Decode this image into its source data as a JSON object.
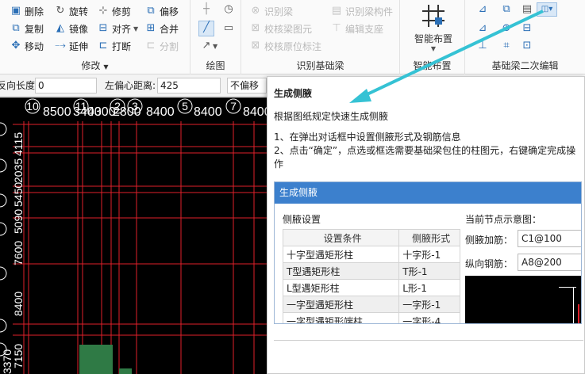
{
  "ribbon": {
    "modify": {
      "label": "修改",
      "buttons": [
        {
          "name": "delete",
          "label": "删除"
        },
        {
          "name": "rotate",
          "label": "旋转"
        },
        {
          "name": "trim",
          "label": "修剪"
        },
        {
          "name": "offset",
          "label": "偏移"
        },
        {
          "name": "copy",
          "label": "复制"
        },
        {
          "name": "mirror",
          "label": "镜像"
        },
        {
          "name": "align",
          "label": "对齐"
        },
        {
          "name": "merge",
          "label": "合并"
        },
        {
          "name": "move",
          "label": "移动"
        },
        {
          "name": "extend",
          "label": "延伸"
        },
        {
          "name": "break",
          "label": "打断"
        },
        {
          "name": "split",
          "label": "分割"
        }
      ]
    },
    "draw": {
      "label": "绘图"
    },
    "identify": {
      "label": "识别基础梁",
      "buttons": [
        {
          "name": "identify-beam",
          "label": "识别梁"
        },
        {
          "name": "identify-beam-member",
          "label": "识别梁构件"
        },
        {
          "name": "check-beam-diagram",
          "label": "校核梁图元"
        },
        {
          "name": "edit-support",
          "label": "编辑支座"
        },
        {
          "name": "check-original-label",
          "label": "校核原位标注"
        }
      ]
    },
    "smart": {
      "label": "智能布置",
      "button": "智能布置"
    },
    "second_edit": {
      "label": "基础梁二次编辑"
    }
  },
  "options": {
    "length_label": "反向长度:",
    "length_value": "0",
    "left_offset_label": "左偏心距离:",
    "left_offset_value": "425",
    "offset_mode": "不偏移"
  },
  "canvas": {
    "axis_labels_top": [
      "10",
      "11",
      "2",
      "3",
      "5",
      "7"
    ],
    "dims_top": [
      "8500",
      "3400",
      "4300",
      "2800",
      "8400",
      "8400",
      "8400"
    ],
    "dims_left": [
      "4115",
      "2035",
      "5450",
      "5090",
      "7600",
      "8400",
      "7150",
      "3370"
    ],
    "bg_color": "#000000",
    "grid_color": "#e0202a"
  },
  "tooltip": {
    "title": "生成侧腋",
    "desc": "根据图纸规定快速生成侧腋",
    "step1": "1、在弹出对话框中设置侧腋形式及钢筋信息",
    "step2": "2、点击“确定”，点选或框选需要基础梁包住的柱图元，右键确定完成操作",
    "dialog": {
      "title": "生成侧腋",
      "section_label": "侧腋设置",
      "preview_label": "当前节点示意图：",
      "columns": [
        "设置条件",
        "侧腋形式"
      ],
      "rows": [
        [
          "十字型遇矩形柱",
          "十字形-1"
        ],
        [
          "T型遇矩形柱",
          "T形-1"
        ],
        [
          "L型遇矩形柱",
          "L形-1"
        ],
        [
          "一字型遇矩形柱",
          "一字形-1"
        ],
        [
          "一字型遇矩形端柱",
          "一字形-4"
        ]
      ],
      "rebar_label": "侧腋加筋：",
      "rebar_value": "C1@100",
      "long_rebar_label": "纵向钢筋：",
      "long_rebar_value": "A8@200"
    }
  },
  "colors": {
    "accent": "#3c80cd",
    "arrow": "#35c2d4",
    "column_fill": "#2f7a45"
  }
}
